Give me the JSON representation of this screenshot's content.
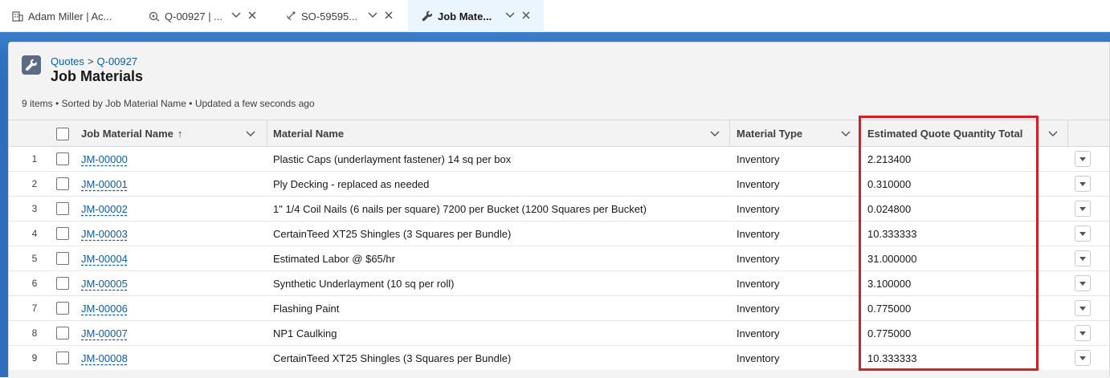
{
  "tabs": [
    {
      "label": "Adam Miller | Ac...",
      "icon": "building-icon"
    },
    {
      "label": "Q-00927 | ...",
      "icon": "quote-icon"
    },
    {
      "label": "SO-59595...",
      "icon": "satellite-icon"
    },
    {
      "label": "Job Mate...",
      "icon": "wrench-icon"
    }
  ],
  "breadcrumb": {
    "parent": "Quotes",
    "separator": ">",
    "record": "Q-00927"
  },
  "page": {
    "title": "Job Materials",
    "meta": "9 items • Sorted by Job Material Name • Updated a few seconds ago"
  },
  "columns": {
    "name": "Job Material Name",
    "name_sort_indicator": "↑",
    "material": "Material Name",
    "type": "Material Type",
    "qty": "Estimated Quote Quantity Total"
  },
  "rows": [
    {
      "num": "1",
      "name": "JM-00000",
      "material": "Plastic Caps (underlayment fastener) 14 sq per box",
      "type": "Inventory",
      "qty": "2.213400"
    },
    {
      "num": "2",
      "name": "JM-00001",
      "material": "Ply Decking - replaced as needed",
      "type": "Inventory",
      "qty": "0.310000"
    },
    {
      "num": "3",
      "name": "JM-00002",
      "material": "1\" 1/4 Coil Nails (6 nails per square) 7200 per Bucket (1200 Squares per Bucket)",
      "type": "Inventory",
      "qty": "0.024800"
    },
    {
      "num": "4",
      "name": "JM-00003",
      "material": "CertainTeed XT25 Shingles (3 Squares per Bundle)",
      "type": "Inventory",
      "qty": "10.333333"
    },
    {
      "num": "5",
      "name": "JM-00004",
      "material": "Estimated Labor @ $65/hr",
      "type": "Inventory",
      "qty": "31.000000"
    },
    {
      "num": "6",
      "name": "JM-00005",
      "material": "Synthetic Underlayment (10 sq per roll)",
      "type": "Inventory",
      "qty": "3.100000"
    },
    {
      "num": "7",
      "name": "JM-00006",
      "material": "Flashing Paint",
      "type": "Inventory",
      "qty": "0.775000"
    },
    {
      "num": "8",
      "name": "JM-00007",
      "material": "NP1 Caulking",
      "type": "Inventory",
      "qty": "0.775000"
    },
    {
      "num": "9",
      "name": "JM-00008",
      "material": "CertainTeed XT25 Shingles (3 Squares per Bundle)",
      "type": "Inventory",
      "qty": "10.333333"
    }
  ],
  "colors": {
    "link": "#0b5cab",
    "brand_band": "#2d72c4",
    "active_tab": "#eaf5fe",
    "highlight_box": "#d32026"
  }
}
